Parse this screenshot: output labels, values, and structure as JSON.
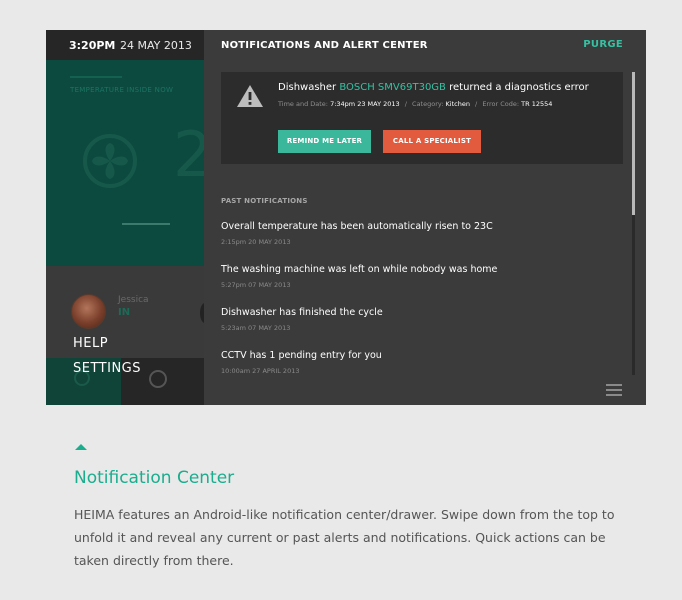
{
  "status_bar": {
    "time": "3:20PM",
    "date": "24 MAY 2013"
  },
  "background_app": {
    "temperature_label": "TEMPERATURE INSIDE NOW",
    "temperature_digit": "2",
    "user": {
      "name": "Jessica",
      "status": "IN"
    },
    "menu": {
      "help": "HELP",
      "settings": "SETTINGS"
    }
  },
  "drawer": {
    "title": "NOTIFICATIONS AND ALERT CENTER",
    "purge_label": "PURGE",
    "alert": {
      "icon": "warning-icon",
      "device": "Dishwasher",
      "model": "BOSCH SMV69T30GB",
      "message_suffix": "returned a diagnostics error",
      "time_label": "Time and Date:",
      "time_value": "7:34pm 23 MAY 2013",
      "category_label": "Category:",
      "category_value": "Kitchen",
      "error_label": "Error Code:",
      "error_value": "TR 12554",
      "remind_label": "REMIND ME LATER",
      "specialist_label": "CALL A SPECIALIST"
    },
    "past_heading": "PAST NOTIFICATIONS",
    "past_items": [
      {
        "text": "Overall temperature has been automatically risen to 23C",
        "time": "2:15pm 20 MAY 2013"
      },
      {
        "text": "The washing machine was left on while nobody was home",
        "time": "5:27pm 07 MAY 2013"
      },
      {
        "text": "Dishwasher has finished the cycle",
        "time": "5:23am 07 MAY 2013"
      },
      {
        "text": "CCTV has 1 pending entry for you",
        "time": "10:00am 27 APRIL 2013"
      }
    ]
  },
  "caption": {
    "title": "Notification Center",
    "body": "HEIMA features an Android-like notification center/drawer. Swipe down from the top to unfold it and reveal any current or past alerts and notifications. Quick actions can be taken directly from there."
  },
  "colors": {
    "accent": "#35c1a2",
    "danger": "#e35b3f",
    "caption_accent": "#1aad8e"
  }
}
